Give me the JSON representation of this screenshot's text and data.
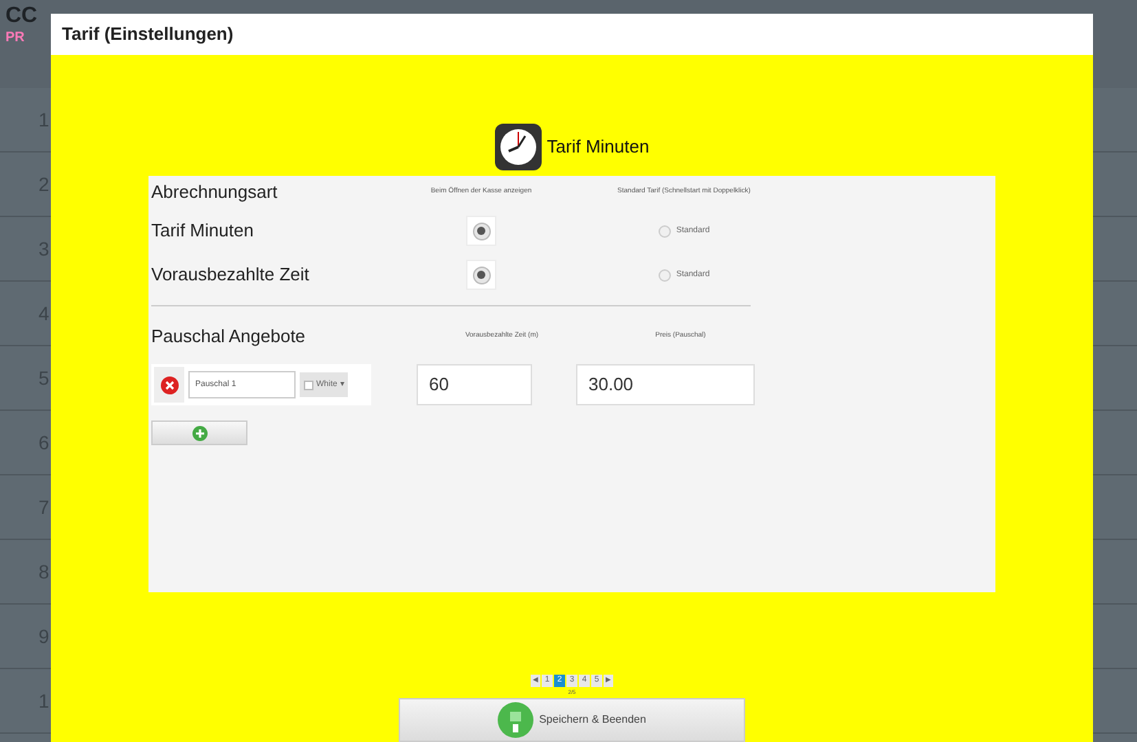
{
  "background": {
    "logo": "CC",
    "logo_sub": "PR",
    "row_numbers": [
      "1",
      "2",
      "3",
      "4",
      "5",
      "6",
      "7",
      "8",
      "9",
      "1"
    ]
  },
  "dialog": {
    "title": "Tarif (Einstellungen)",
    "heading": "Tarif Minuten",
    "billing": {
      "label": "Abrechnungsart",
      "col_show": "Beim Öffnen der Kasse anzeigen",
      "col_default": "Standard Tarif (Schnellstart mit Doppelklick)",
      "rows": [
        {
          "name": "Tarif Minuten",
          "shown": true,
          "default_label": "Standard",
          "default": false
        },
        {
          "name": "Vorausbezahlte Zeit",
          "shown": true,
          "default_label": "Standard",
          "default": false
        }
      ]
    },
    "packages": {
      "label": "Pauschal Angebote",
      "col_time": "Vorausbezahlte Zeit (m)",
      "col_price": "Preis (Pauschal)",
      "items": [
        {
          "name": "Pauschal 1",
          "color_label": "White",
          "color": "#ffffff",
          "dropdown_caret": "▾",
          "time": "60",
          "price": "30.00"
        }
      ]
    },
    "pagination": {
      "prev": "◀",
      "next": "▶",
      "pages": [
        {
          "label": "1",
          "selected": false
        },
        {
          "label": "2",
          "selected": true
        },
        {
          "label": "3",
          "selected": false
        },
        {
          "label": "4",
          "selected": false
        },
        {
          "label": "5",
          "selected": false
        }
      ],
      "counter": "2/5"
    },
    "save_button": "Speichern & Beenden"
  }
}
